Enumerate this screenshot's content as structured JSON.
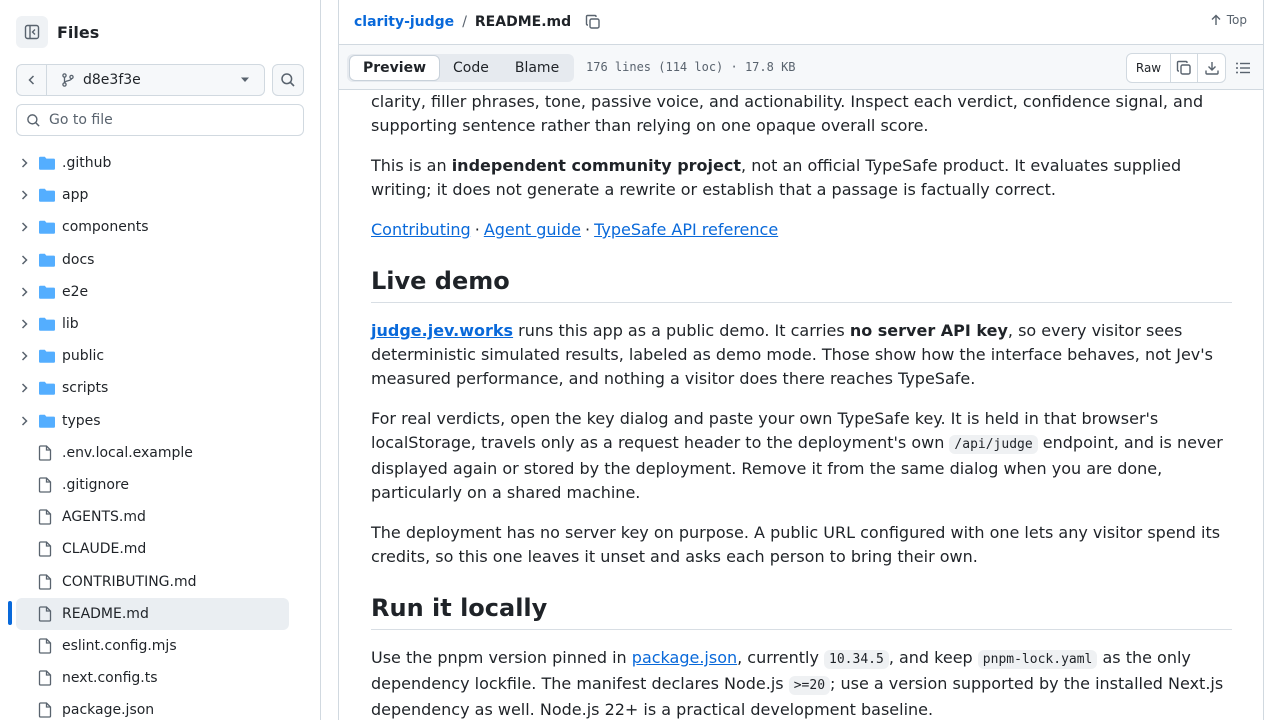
{
  "sidebar": {
    "title": "Files",
    "branch": "d8e3f3e",
    "goto_placeholder": "Go to file",
    "items": [
      {
        "name": ".github",
        "type": "dir"
      },
      {
        "name": "app",
        "type": "dir"
      },
      {
        "name": "components",
        "type": "dir"
      },
      {
        "name": "docs",
        "type": "dir"
      },
      {
        "name": "e2e",
        "type": "dir"
      },
      {
        "name": "lib",
        "type": "dir"
      },
      {
        "name": "public",
        "type": "dir"
      },
      {
        "name": "scripts",
        "type": "dir"
      },
      {
        "name": "types",
        "type": "dir"
      },
      {
        "name": ".env.local.example",
        "type": "file"
      },
      {
        "name": ".gitignore",
        "type": "file"
      },
      {
        "name": "AGENTS.md",
        "type": "file"
      },
      {
        "name": "CLAUDE.md",
        "type": "file"
      },
      {
        "name": "CONTRIBUTING.md",
        "type": "file"
      },
      {
        "name": "README.md",
        "type": "file",
        "selected": true
      },
      {
        "name": "eslint.config.mjs",
        "type": "file"
      },
      {
        "name": "next.config.ts",
        "type": "file"
      },
      {
        "name": "package.json",
        "type": "file"
      }
    ]
  },
  "header": {
    "repo": "clarity-judge",
    "separator": "/",
    "file": "README.md",
    "top_label": "Top"
  },
  "toolbar": {
    "tabs": [
      "Preview",
      "Code",
      "Blame"
    ],
    "active_tab": "Preview",
    "meta": "176 lines (114 loc) · 17.8 KB",
    "raw_label": "Raw"
  },
  "readme": {
    "p0": "clarity, filler phrases, tone, passive voice, and actionability. Inspect each verdict, confidence signal, and supporting sentence rather than relying on one opaque overall score.",
    "p1_a": "This is an ",
    "p1_b": "independent community project",
    "p1_c": ", not an official TypeSafe product. It evaluates supplied writing; it does not generate a rewrite or establish that a passage is factually correct.",
    "links": [
      "Contributing",
      "Agent guide",
      "TypeSafe API reference"
    ],
    "link_sep": "·",
    "h_demo": "Live demo",
    "p2_link": "judge.jev.works",
    "p2_a": " runs this app as a public demo. It carries ",
    "p2_b": "no server API key",
    "p2_c": ", so every visitor sees deterministic simulated results, labeled as demo mode. Those show how the interface behaves, not Jev's measured performance, and nothing a visitor does there reaches TypeSafe.",
    "p3_a": "For real verdicts, open the key dialog and paste your own TypeSafe key. It is held in that browser's localStorage, travels only as a request header to the deployment's own ",
    "p3_code": "/api/judge",
    "p3_b": " endpoint, and is never displayed again or stored by the deployment. Remove it from the same dialog when you are done, particularly on a shared machine.",
    "p4": "The deployment has no server key on purpose. A public URL configured with one lets any visitor spend its credits, so this one leaves it unset and asks each person to bring their own.",
    "h_local": "Run it locally",
    "p5_a": "Use the pnpm version pinned in ",
    "p5_link": "package.json",
    "p5_b": ", currently ",
    "p5_code1": "10.34.5",
    "p5_c": ", and keep ",
    "p5_code2": "pnpm-lock.yaml",
    "p5_d": " as the only dependency lockfile. The manifest declares Node.js ",
    "p5_code3": ">=20",
    "p5_e": "; use a version supported by the installed Next.js dependency as well. Node.js 22+ is a practical development baseline."
  }
}
